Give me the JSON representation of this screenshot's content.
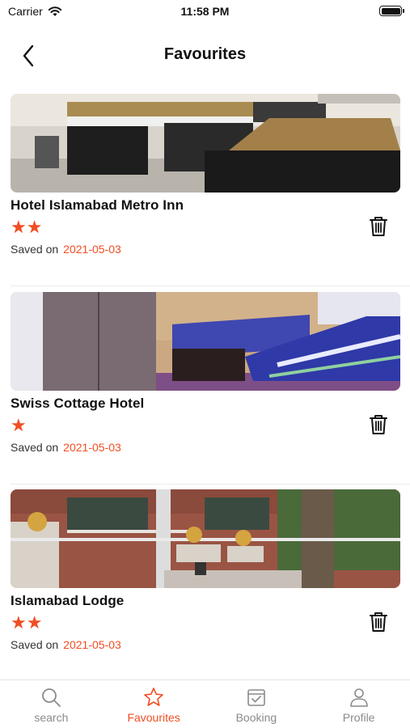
{
  "status_bar": {
    "carrier": "Carrier",
    "time": "11:58 PM"
  },
  "header": {
    "title": "Favourites"
  },
  "favourites": [
    {
      "name": "Hotel Islamabad Metro Inn",
      "stars": "★★",
      "rating": 2,
      "saved_label": "Saved on",
      "saved_date": "2021-05-03"
    },
    {
      "name": "Swiss Cottage Hotel",
      "stars": "★",
      "rating": 1,
      "saved_label": "Saved on",
      "saved_date": "2021-05-03"
    },
    {
      "name": "Islamabad Lodge",
      "stars": "★★",
      "rating": 2,
      "saved_label": "Saved on",
      "saved_date": "2021-05-03"
    }
  ],
  "tabs": [
    {
      "label": "search",
      "icon": "search-icon"
    },
    {
      "label": "Favourites",
      "icon": "star-icon",
      "active": true
    },
    {
      "label": "Booking",
      "icon": "calendar-check-icon"
    },
    {
      "label": "Profile",
      "icon": "person-icon"
    }
  ],
  "colors": {
    "accent": "#f04e23",
    "inactive_tab": "#8a8a8a"
  }
}
